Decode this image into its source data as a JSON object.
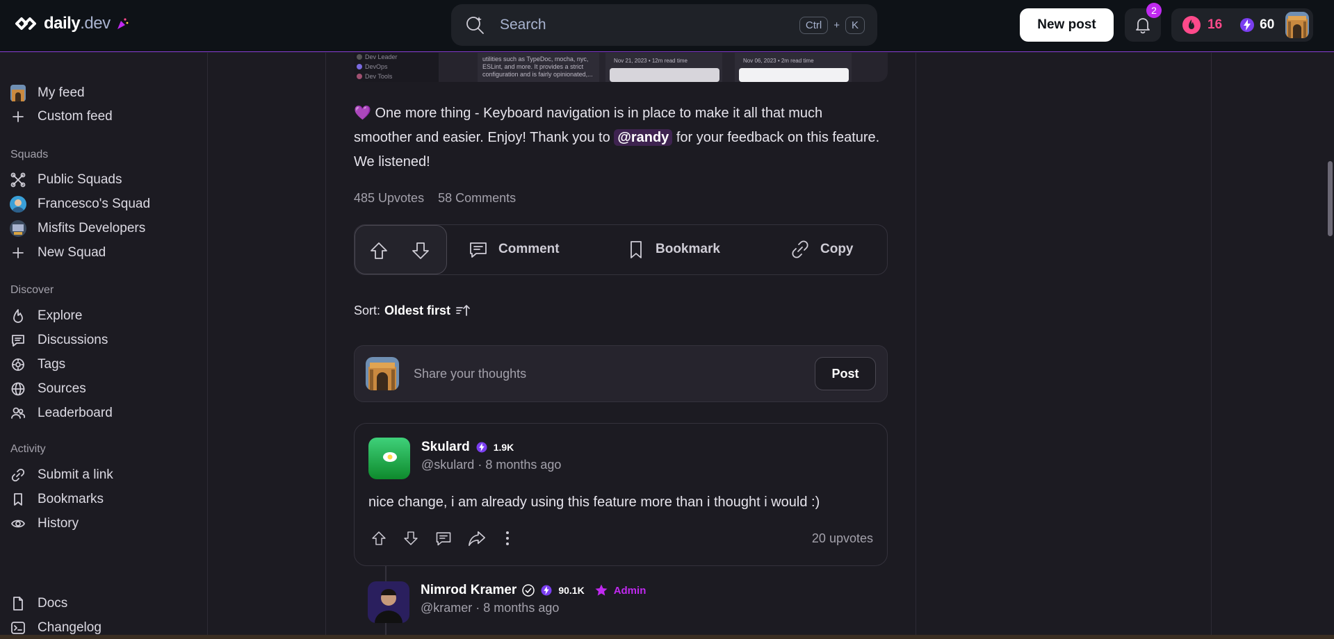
{
  "header": {
    "logo_word": "daily",
    "logo_suffix": ".dev",
    "search_placeholder": "Search",
    "kbd_ctrl": "Ctrl",
    "kbd_plus": "+",
    "kbd_k": "K",
    "new_post_label": "New post",
    "notification_count": "2",
    "streak": "16",
    "reputation": "60"
  },
  "sidebar": {
    "top": [
      {
        "label": "My feed",
        "icon": "avatar"
      },
      {
        "label": "Custom feed",
        "icon": "plus-icon"
      }
    ],
    "squads_heading": "Squads",
    "squads": [
      {
        "label": "Public Squads",
        "icon": "squads-icon"
      },
      {
        "label": "Francesco's Squad",
        "icon": "avatar"
      },
      {
        "label": "Misfits Developers",
        "icon": "avatar"
      },
      {
        "label": "New Squad",
        "icon": "plus-icon"
      }
    ],
    "discover_heading": "Discover",
    "discover": [
      {
        "label": "Explore",
        "icon": "flame-icon"
      },
      {
        "label": "Discussions",
        "icon": "chat-icon"
      },
      {
        "label": "Tags",
        "icon": "tag-icon"
      },
      {
        "label": "Sources",
        "icon": "globe-icon"
      },
      {
        "label": "Leaderboard",
        "icon": "users-icon"
      }
    ],
    "activity_heading": "Activity",
    "activity": [
      {
        "label": "Submit a link",
        "icon": "link-icon"
      },
      {
        "label": "Bookmarks",
        "icon": "bookmark-icon"
      },
      {
        "label": "History",
        "icon": "eye-icon"
      }
    ],
    "bottom": [
      {
        "label": "Docs",
        "icon": "doc-icon"
      },
      {
        "label": "Changelog",
        "icon": "terminal-icon"
      }
    ]
  },
  "post": {
    "thumbnail": {
      "menu": [
        "Dev Leader",
        "DevOps",
        "Dev Tools"
      ],
      "card_text": "utilities such as TypeDoc, mocha, nyc, ESLint, and more. It provides a strict configuration and is fairly opinionated,...",
      "meta1": "Nov 21, 2023 • 12m read time",
      "meta2": "Nov 06, 2023 • 2m read time"
    },
    "text_before": "One more thing - Keyboard navigation is in place to make it all that much smoother and easier. Enjoy! Thank you to",
    "mention": "@randy",
    "text_after": "for your feedback on this feature. We listened!",
    "upvotes": "485 Upvotes",
    "comments": "58 Comments",
    "actions": {
      "comment": "Comment",
      "bookmark": "Bookmark",
      "copy": "Copy"
    }
  },
  "sort": {
    "label": "Sort:",
    "value": "Oldest first"
  },
  "composer": {
    "placeholder": "Share your thoughts",
    "post_label": "Post"
  },
  "comments": [
    {
      "name": "Skulard",
      "reputation": "1.9K",
      "handle": "@skulard",
      "time": "8 months ago",
      "body": "nice change, i am already using this feature more than i thought i would :)",
      "upvotes": "20 upvotes"
    }
  ],
  "reply": {
    "name": "Nimrod Kramer",
    "reputation": "90.1K",
    "role": "Admin",
    "handle": "@kramer",
    "time": "8 months ago"
  },
  "colors": {
    "accent": "#c029f0",
    "streak": "#ff4a8b",
    "background": "#1c1b22",
    "header": "#0e1217"
  }
}
